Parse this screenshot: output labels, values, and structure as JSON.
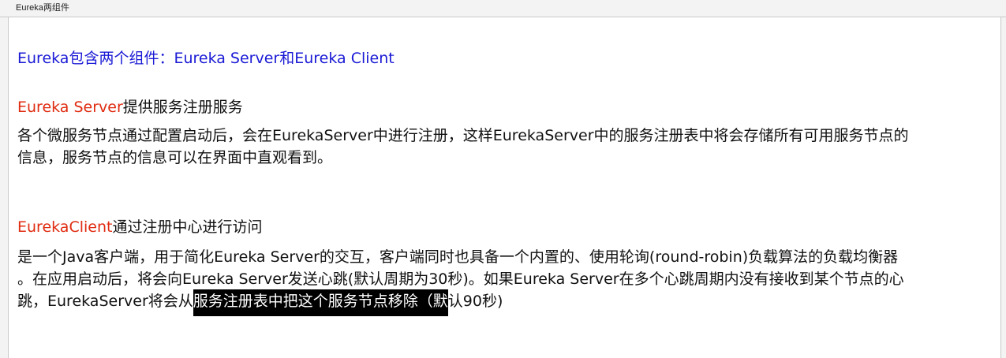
{
  "window": {
    "title": "Eureka两组件"
  },
  "document": {
    "heading": "Eureka包含两个组件：Eureka Server和Eureka Client",
    "server": {
      "name": "Eureka Server",
      "title_suffix": "提供服务注册服务",
      "para_line1": "各个微服务节点通过配置启动后，会在EurekaServer中进行注册，这样EurekaServer中的服务注册表中将会存储所有可用服务节点的",
      "para_line2": "信息，服务节点的信息可以在界面中直观看到。"
    },
    "client": {
      "name": "EurekaClient",
      "title_suffix": "通过注册中心进行访问",
      "para_line1": "是一个Java客户端，用于简化Eureka Server的交互，客户端同时也具备一个内置的、使用轮询(round-robin)负载算法的负载均衡器",
      "para_line2": "。在应用启动后，将会向Eureka Server发送心跳(默认周期为30秒)。如果Eureka Server在多个心跳周期内没有接收到某个节点的心",
      "para_line3_plain": "跳，EurekaServer将会从",
      "para_line3_highlight": "服务注册表中把这个服务节点移除（默",
      "para_line3_rest": "认90秒)"
    }
  },
  "colors": {
    "heading": "#1a1ad6",
    "term": "#e02b10",
    "body_text": "#111111",
    "highlight_bg": "#000000",
    "highlight_text": "#ffffff"
  }
}
